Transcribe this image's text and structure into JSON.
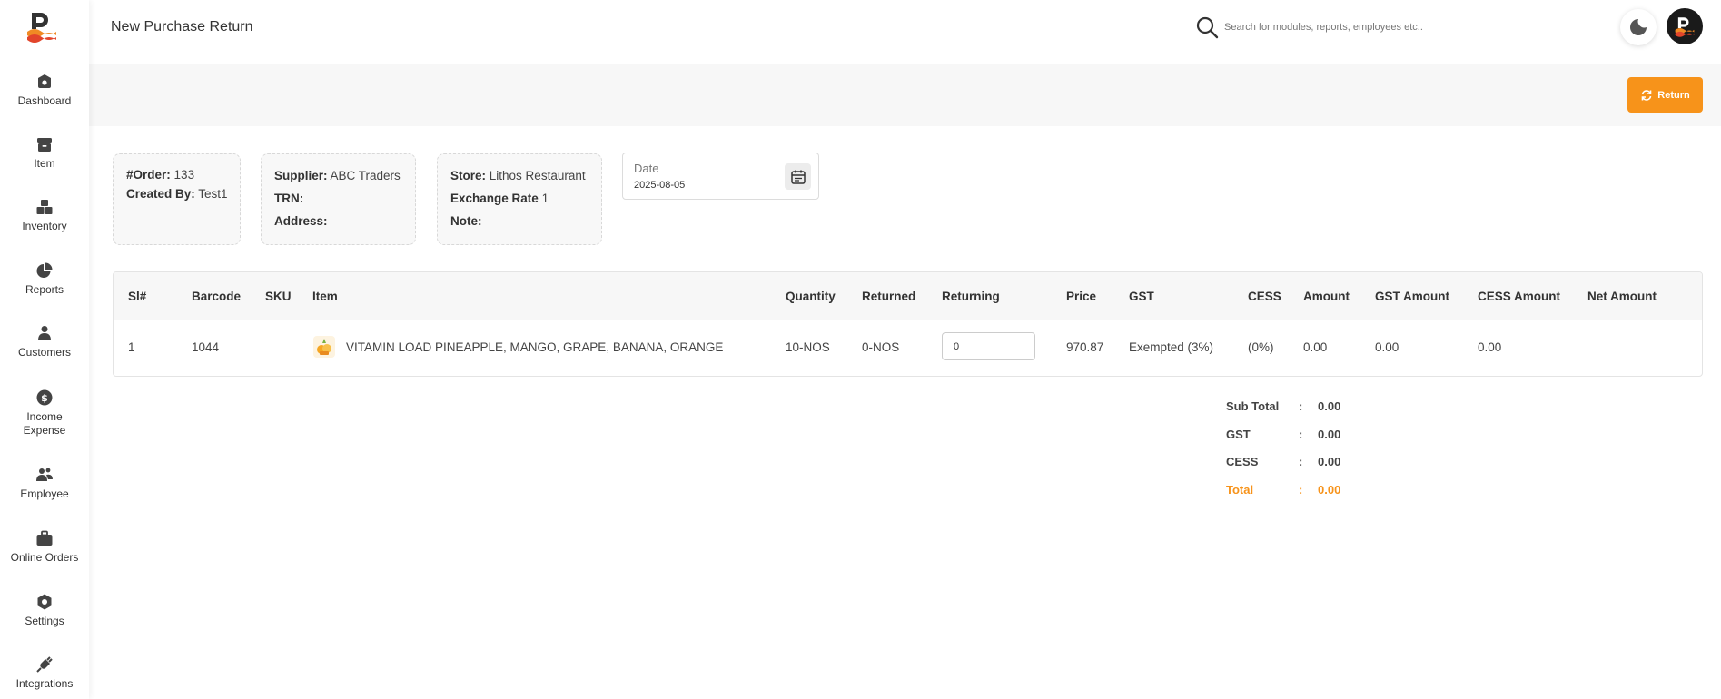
{
  "header": {
    "title": "New Purchase Return",
    "search_placeholder": "Search for modules, reports, employees etc.."
  },
  "sidebar": {
    "items": [
      {
        "label": "Dashboard",
        "icon": "dashboard-icon"
      },
      {
        "label": "Item",
        "icon": "item-box-icon"
      },
      {
        "label": "Inventory",
        "icon": "inventory-icon"
      },
      {
        "label": "Reports",
        "icon": "pie-chart-icon"
      },
      {
        "label": "Customers",
        "icon": "customers-icon"
      },
      {
        "label": "Income\nExpense",
        "icon": "dollar-icon"
      },
      {
        "label": "Employee",
        "icon": "employee-icon"
      },
      {
        "label": "Online Orders",
        "icon": "briefcase-icon"
      },
      {
        "label": "Settings",
        "icon": "settings-icon"
      },
      {
        "label": "Integrations",
        "icon": "plug-icon"
      }
    ]
  },
  "toolbar": {
    "return_label": "Return"
  },
  "order": {
    "order_label": "#Order:",
    "order_no": "133",
    "created_by_label": "Created By:",
    "created_by": "Test1"
  },
  "supplier": {
    "supplier_label": "Supplier:",
    "supplier": "ABC Traders",
    "trn_label": "TRN:",
    "trn": "",
    "address_label": "Address:",
    "address": ""
  },
  "store": {
    "store_label": "Store:",
    "store": "Lithos Restaurant",
    "exchange_label": "Exchange Rate",
    "exchange_rate": "1",
    "note_label": "Note:",
    "note": ""
  },
  "date": {
    "label": "Date",
    "value": "2025-08-05"
  },
  "table": {
    "headers": {
      "sl": "Sl#",
      "barcode": "Barcode",
      "sku": "SKU",
      "item": "Item",
      "quantity": "Quantity",
      "returned": "Returned",
      "returning": "Returning",
      "price": "Price",
      "gst": "GST",
      "cess": "CESS",
      "amount": "Amount",
      "gst_amount": "GST Amount",
      "cess_amount": "CESS Amount",
      "net_amount": "Net Amount"
    },
    "rows": [
      {
        "sl": "1",
        "barcode": "1044",
        "sku": "",
        "item": "VITAMIN LOAD PINEAPPLE, MANGO, GRAPE, BANANA, ORANGE",
        "quantity": "10-NOS",
        "returned": "0-NOS",
        "returning": "0",
        "price": "970.87",
        "gst": "Exempted (3%)",
        "cess": "(0%)",
        "amount": "0.00",
        "gst_amount": "0.00",
        "cess_amount": "0.00",
        "net_amount": ""
      }
    ]
  },
  "totals": {
    "sub_total_label": "Sub Total",
    "sub_total": "0.00",
    "gst_label": "GST",
    "gst": "0.00",
    "cess_label": "CESS",
    "cess": "0.00",
    "total_label": "Total",
    "total": "0.00",
    "colon": ":"
  },
  "colors": {
    "accent": "#f7931a",
    "sidebar_icon": "#444444"
  }
}
